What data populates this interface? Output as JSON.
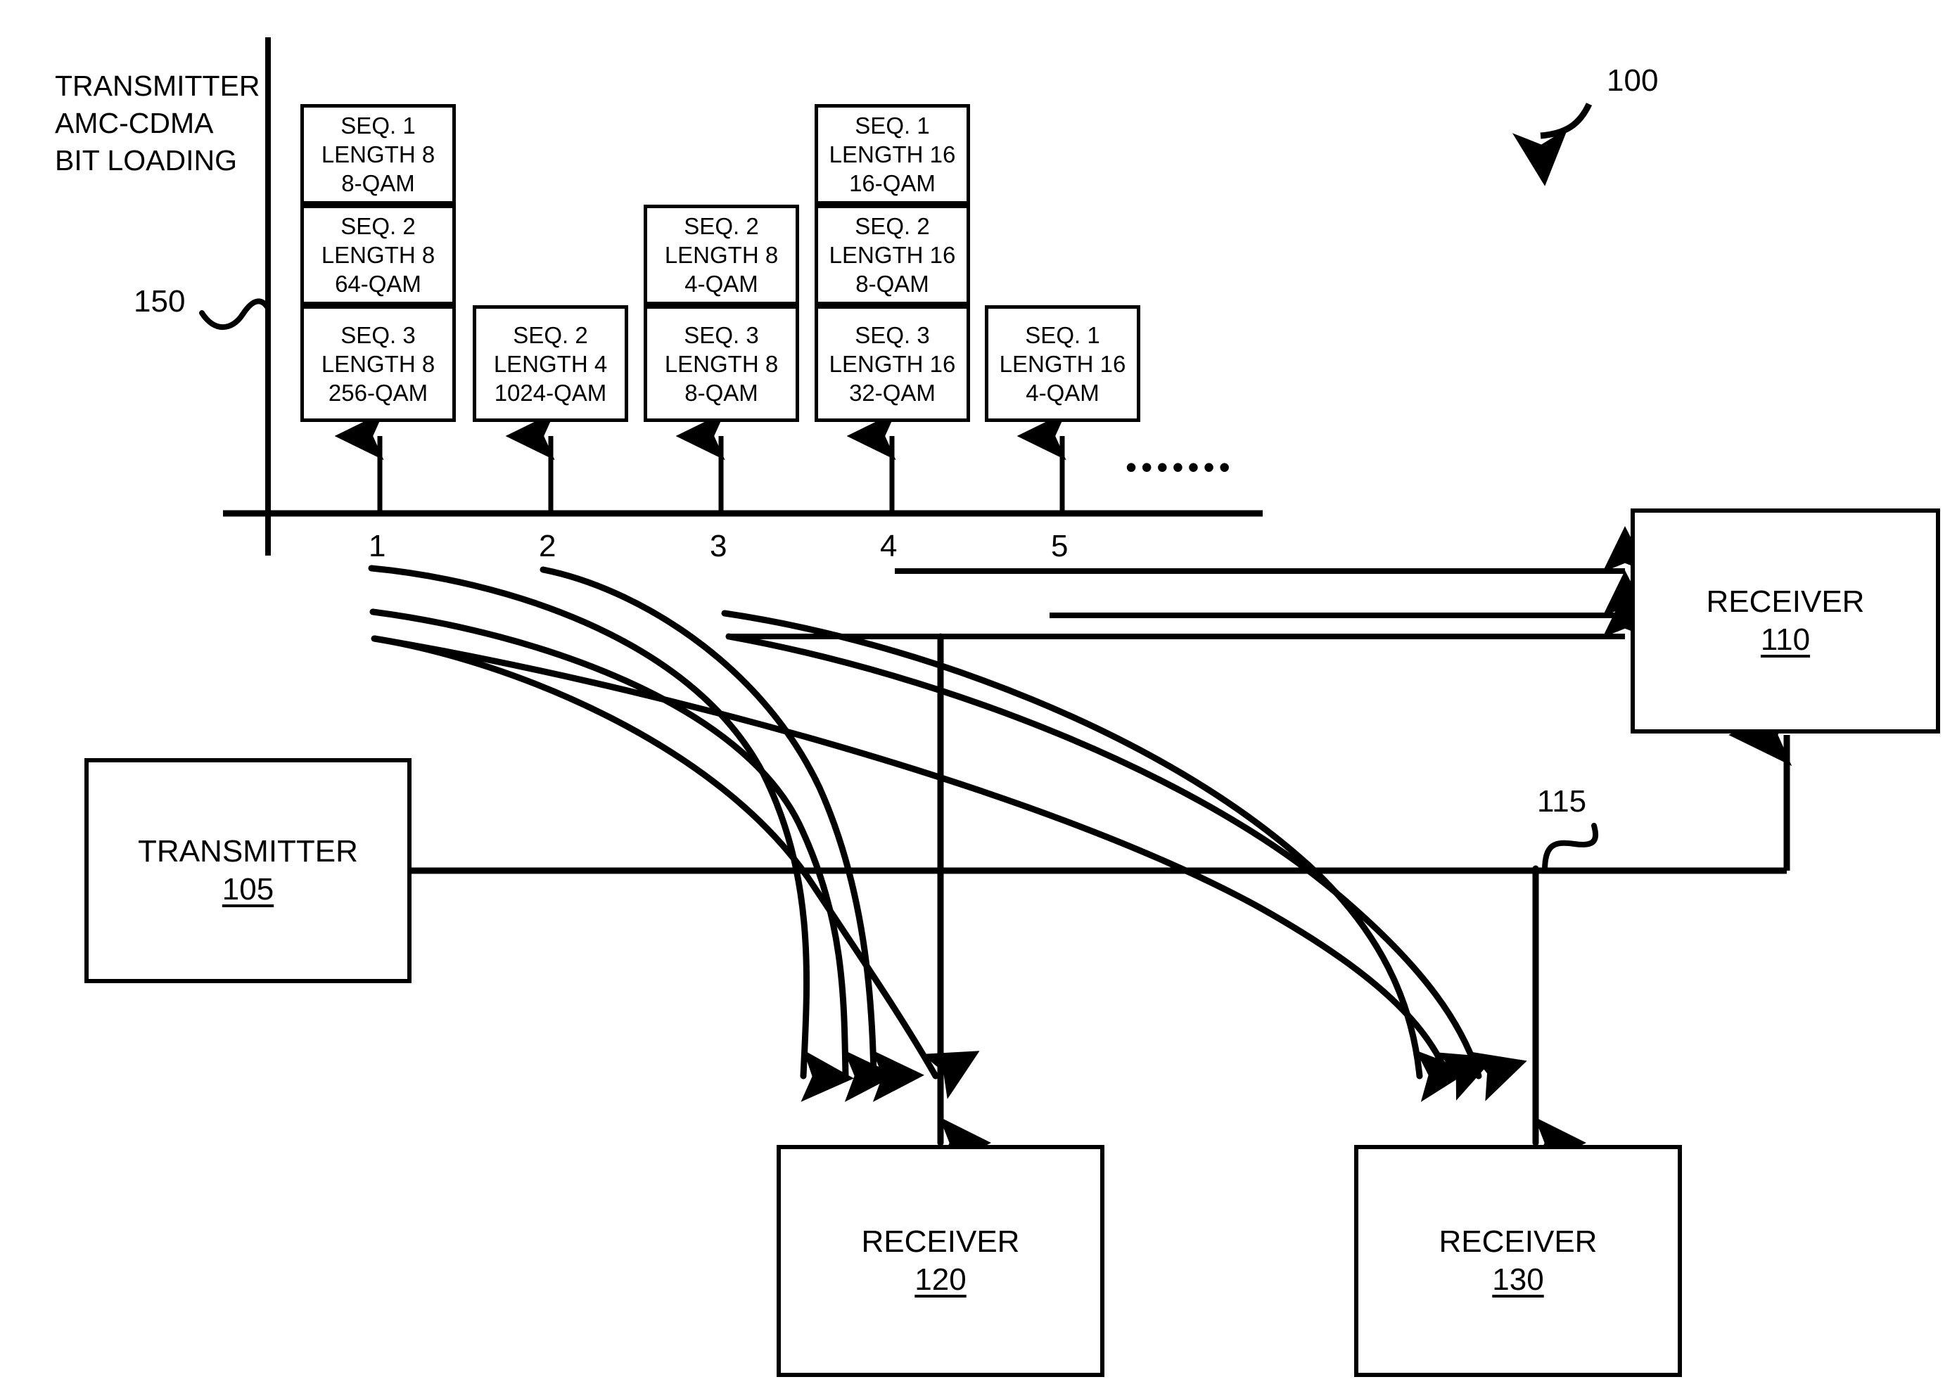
{
  "figure": {
    "number": "100",
    "axis_label_lines": [
      "TRANSMITTER",
      "AMC-CDMA",
      "BIT LOADING"
    ],
    "bitloading_ref": "150",
    "channel_ref": "115",
    "ellipsis": "•••••••",
    "line_color": "#000000",
    "background": "#ffffff"
  },
  "axis": {
    "tick_labels": [
      "1",
      "2",
      "3",
      "4",
      "5"
    ]
  },
  "columns": [
    {
      "tick": "1",
      "boxes": [
        {
          "seq": "SEQ. 1",
          "length": "LENGTH 8",
          "qam": "8-QAM"
        },
        {
          "seq": "SEQ. 2",
          "length": "LENGTH 8",
          "qam": "64-QAM"
        },
        {
          "seq": "SEQ. 3",
          "length": "LENGTH 8",
          "qam": "256-QAM"
        }
      ]
    },
    {
      "tick": "2",
      "boxes": [
        {
          "seq": "SEQ. 2",
          "length": "LENGTH 4",
          "qam": "1024-QAM"
        }
      ]
    },
    {
      "tick": "3",
      "boxes": [
        {
          "seq": "SEQ. 2",
          "length": "LENGTH 8",
          "qam": "4-QAM"
        },
        {
          "seq": "SEQ. 3",
          "length": "LENGTH 8",
          "qam": "8-QAM"
        }
      ]
    },
    {
      "tick": "4",
      "boxes": [
        {
          "seq": "SEQ. 1",
          "length": "LENGTH 16",
          "qam": "16-QAM"
        },
        {
          "seq": "SEQ. 2",
          "length": "LENGTH 16",
          "qam": "8-QAM"
        },
        {
          "seq": "SEQ. 3",
          "length": "LENGTH 16",
          "qam": "32-QAM"
        }
      ]
    },
    {
      "tick": "5",
      "boxes": [
        {
          "seq": "SEQ. 1",
          "length": "LENGTH 16",
          "qam": "4-QAM"
        }
      ]
    }
  ],
  "blocks": {
    "transmitter": {
      "title": "TRANSMITTER",
      "ref": "105"
    },
    "receiver_110": {
      "title": "RECEIVER",
      "ref": "110"
    },
    "receiver_120": {
      "title": "RECEIVER",
      "ref": "120"
    },
    "receiver_130": {
      "title": "RECEIVER",
      "ref": "130"
    }
  }
}
